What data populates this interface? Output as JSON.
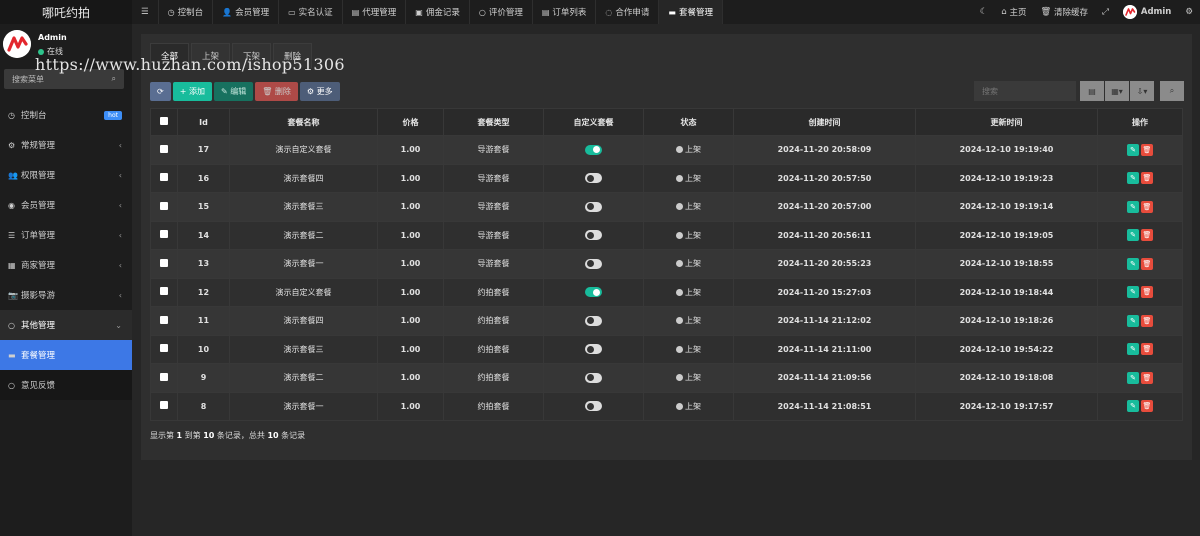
{
  "app": {
    "brand": "哪吒约拍"
  },
  "user": {
    "name": "Admin",
    "status": "在线"
  },
  "sidebar": {
    "search_placeholder": "搜索菜单",
    "items": [
      {
        "icon": "dashboard-icon",
        "glyph": "◷",
        "label": "控制台",
        "badge": "hot"
      },
      {
        "icon": "gears-icon",
        "glyph": "⚙",
        "label": "常规管理",
        "chevron": "‹"
      },
      {
        "icon": "users-icon",
        "glyph": "👥",
        "label": "权限管理",
        "chevron": "‹"
      },
      {
        "icon": "user-circle-icon",
        "glyph": "◉",
        "label": "会员管理",
        "chevron": "‹"
      },
      {
        "icon": "list-icon",
        "glyph": "☰",
        "label": "订单管理",
        "chevron": "‹"
      },
      {
        "icon": "store-icon",
        "glyph": "▦",
        "label": "商家管理",
        "chevron": "‹"
      },
      {
        "icon": "camera-icon",
        "glyph": "📷",
        "label": "摄影导游",
        "chevron": "‹"
      },
      {
        "icon": "circle-icon",
        "glyph": "○",
        "label": "其他管理",
        "chevron": "⌄"
      },
      {
        "icon": "package-icon",
        "glyph": "▬",
        "label": "套餐管理"
      },
      {
        "icon": "circle-small-icon",
        "glyph": "○",
        "label": "意见反馈"
      }
    ]
  },
  "topnav": {
    "menu_glyph": "☰",
    "tabs": [
      {
        "icon": "dashboard-icon",
        "glyph": "◷",
        "label": "控制台"
      },
      {
        "icon": "user-icon",
        "glyph": "👤",
        "label": "会员管理"
      },
      {
        "icon": "id-card-icon",
        "glyph": "▭",
        "label": "实名认证"
      },
      {
        "icon": "agent-icon",
        "glyph": "▤",
        "label": "代理管理"
      },
      {
        "icon": "money-icon",
        "glyph": "▣",
        "label": "佣金记录"
      },
      {
        "icon": "comment-icon",
        "glyph": "○",
        "label": "评价管理"
      },
      {
        "icon": "orders-icon",
        "glyph": "▤",
        "label": "订单列表"
      },
      {
        "icon": "whatsapp-icon",
        "glyph": "◌",
        "label": "合作申请"
      },
      {
        "icon": "package-icon",
        "glyph": "▬",
        "label": "套餐管理"
      }
    ],
    "right": {
      "theme_glyph": "☾",
      "home_label": "主页",
      "clear_cache_label": "清除缓存",
      "fullscreen_glyph": "⤢",
      "admin_label": "Admin",
      "settings_glyph": "⚙"
    }
  },
  "filter_tabs": [
    "全部",
    "上架",
    "下架",
    "删除"
  ],
  "toolbar": {
    "refresh_glyph": "⟳",
    "add_label": "添加",
    "edit_label": "编辑",
    "delete_label": "删除",
    "more_label": "更多"
  },
  "search": {
    "placeholder": "搜索"
  },
  "table": {
    "headers": [
      "Id",
      "套餐名称",
      "价格",
      "套餐类型",
      "自定义套餐",
      "状态",
      "创建时间",
      "更新时间",
      "操作"
    ],
    "rows": [
      {
        "id": "17",
        "name": "演示自定义套餐",
        "price": "1.00",
        "type": "导游套餐",
        "custom": true,
        "status": "上架",
        "created": "2024-11-20 20:58:09",
        "updated": "2024-12-10 19:19:40"
      },
      {
        "id": "16",
        "name": "演示套餐四",
        "price": "1.00",
        "type": "导游套餐",
        "custom": false,
        "status": "上架",
        "created": "2024-11-20 20:57:50",
        "updated": "2024-12-10 19:19:23"
      },
      {
        "id": "15",
        "name": "演示套餐三",
        "price": "1.00",
        "type": "导游套餐",
        "custom": false,
        "status": "上架",
        "created": "2024-11-20 20:57:00",
        "updated": "2024-12-10 19:19:14"
      },
      {
        "id": "14",
        "name": "演示套餐二",
        "price": "1.00",
        "type": "导游套餐",
        "custom": false,
        "status": "上架",
        "created": "2024-11-20 20:56:11",
        "updated": "2024-12-10 19:19:05"
      },
      {
        "id": "13",
        "name": "演示套餐一",
        "price": "1.00",
        "type": "导游套餐",
        "custom": false,
        "status": "上架",
        "created": "2024-11-20 20:55:23",
        "updated": "2024-12-10 19:18:55"
      },
      {
        "id": "12",
        "name": "演示自定义套餐",
        "price": "1.00",
        "type": "约拍套餐",
        "custom": true,
        "status": "上架",
        "created": "2024-11-20 15:27:03",
        "updated": "2024-12-10 19:18:44"
      },
      {
        "id": "11",
        "name": "演示套餐四",
        "price": "1.00",
        "type": "约拍套餐",
        "custom": false,
        "status": "上架",
        "created": "2024-11-14 21:12:02",
        "updated": "2024-12-10 19:18:26"
      },
      {
        "id": "10",
        "name": "演示套餐三",
        "price": "1.00",
        "type": "约拍套餐",
        "custom": false,
        "status": "上架",
        "created": "2024-11-14 21:11:00",
        "updated": "2024-12-10 19:54:22"
      },
      {
        "id": "9",
        "name": "演示套餐二",
        "price": "1.00",
        "type": "约拍套餐",
        "custom": false,
        "status": "上架",
        "created": "2024-11-14 21:09:56",
        "updated": "2024-12-10 19:18:08"
      },
      {
        "id": "8",
        "name": "演示套餐一",
        "price": "1.00",
        "type": "约拍套餐",
        "custom": false,
        "status": "上架",
        "created": "2024-11-14 21:08:51",
        "updated": "2024-12-10 19:17:57"
      }
    ]
  },
  "pager": {
    "prefix": "显示第",
    "from": "1",
    "mid1": "到第",
    "to": "10",
    "mid2": "条记录，总共",
    "total": "10",
    "suffix": "条记录"
  },
  "watermark": "https://www.huzhan.com/ishop51306",
  "colors": {
    "accent": "#18bc9c",
    "active_menu": "#3d78e6",
    "danger": "#e74c3c"
  }
}
